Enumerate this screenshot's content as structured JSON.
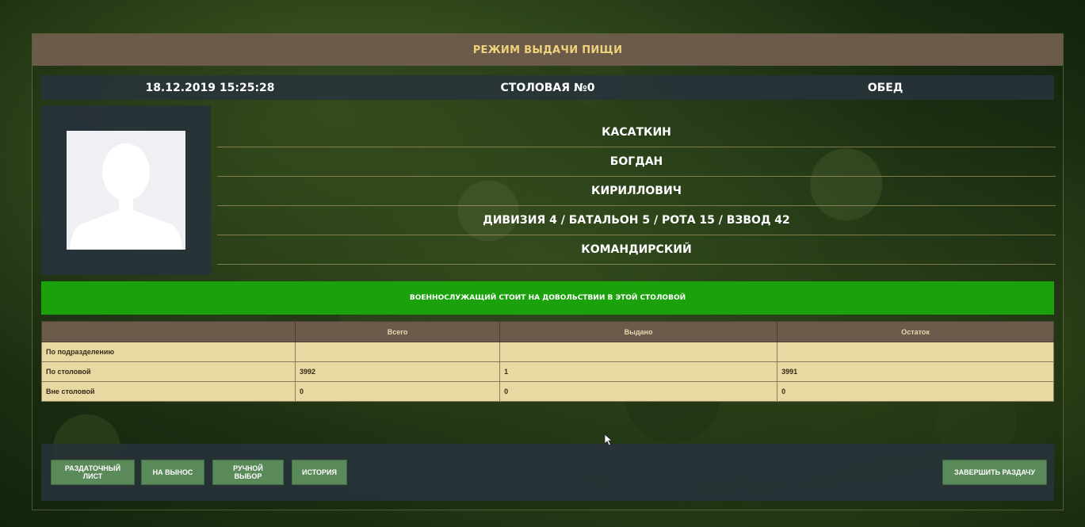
{
  "header": {
    "title": "РЕЖИМ ВЫДАЧИ ПИЩИ"
  },
  "info": {
    "datetime": "18.12.2019 15:25:28",
    "canteen": "СТОЛОВАЯ №0",
    "meal": "ОБЕД"
  },
  "person": {
    "last_name": "КАСАТКИН",
    "first_name": "БОГДАН",
    "patronymic": "КИРИЛЛОВИЧ",
    "unit": "ДИВИЗИЯ 4 / БАТАЛЬОН 5 / РОТА 15 / ВЗВОД 42",
    "ration": "КОМАНДИРСКИЙ"
  },
  "status": {
    "message": "ВОЕННОСЛУЖАЩИЙ СТОИТ НА ДОВОЛЬСТВИИ В ЭТОЙ СТОЛОВОЙ",
    "color": "#1aa10c"
  },
  "stats": {
    "headers": [
      "",
      "Всего",
      "Выдано",
      "Остаток"
    ],
    "rows": [
      [
        "По подразделению",
        "",
        "",
        ""
      ],
      [
        "По столовой",
        "3992",
        "1",
        "3991"
      ],
      [
        "Вне столовой",
        "0",
        "0",
        "0"
      ]
    ]
  },
  "buttons": {
    "handout_sheet_line1": "РАЗДАТОЧНЫЙ",
    "handout_sheet_line2": "ЛИСТ",
    "takeaway": "НА ВЫНОС",
    "manual_line1": "РУЧНОЙ",
    "manual_line2": "ВЫБОР",
    "history": "ИСТОРИЯ",
    "finish": "ЗАВЕРШИТЬ РАЗДАЧУ"
  },
  "icons": {
    "photo": "user-silhouette-icon",
    "cursor": "mouse-pointer-icon"
  },
  "colors": {
    "title_bar": "#6b5b4a",
    "title_text": "#f0d27a",
    "table_cell": "#e6d9a2",
    "button": "#5a8a5a"
  }
}
